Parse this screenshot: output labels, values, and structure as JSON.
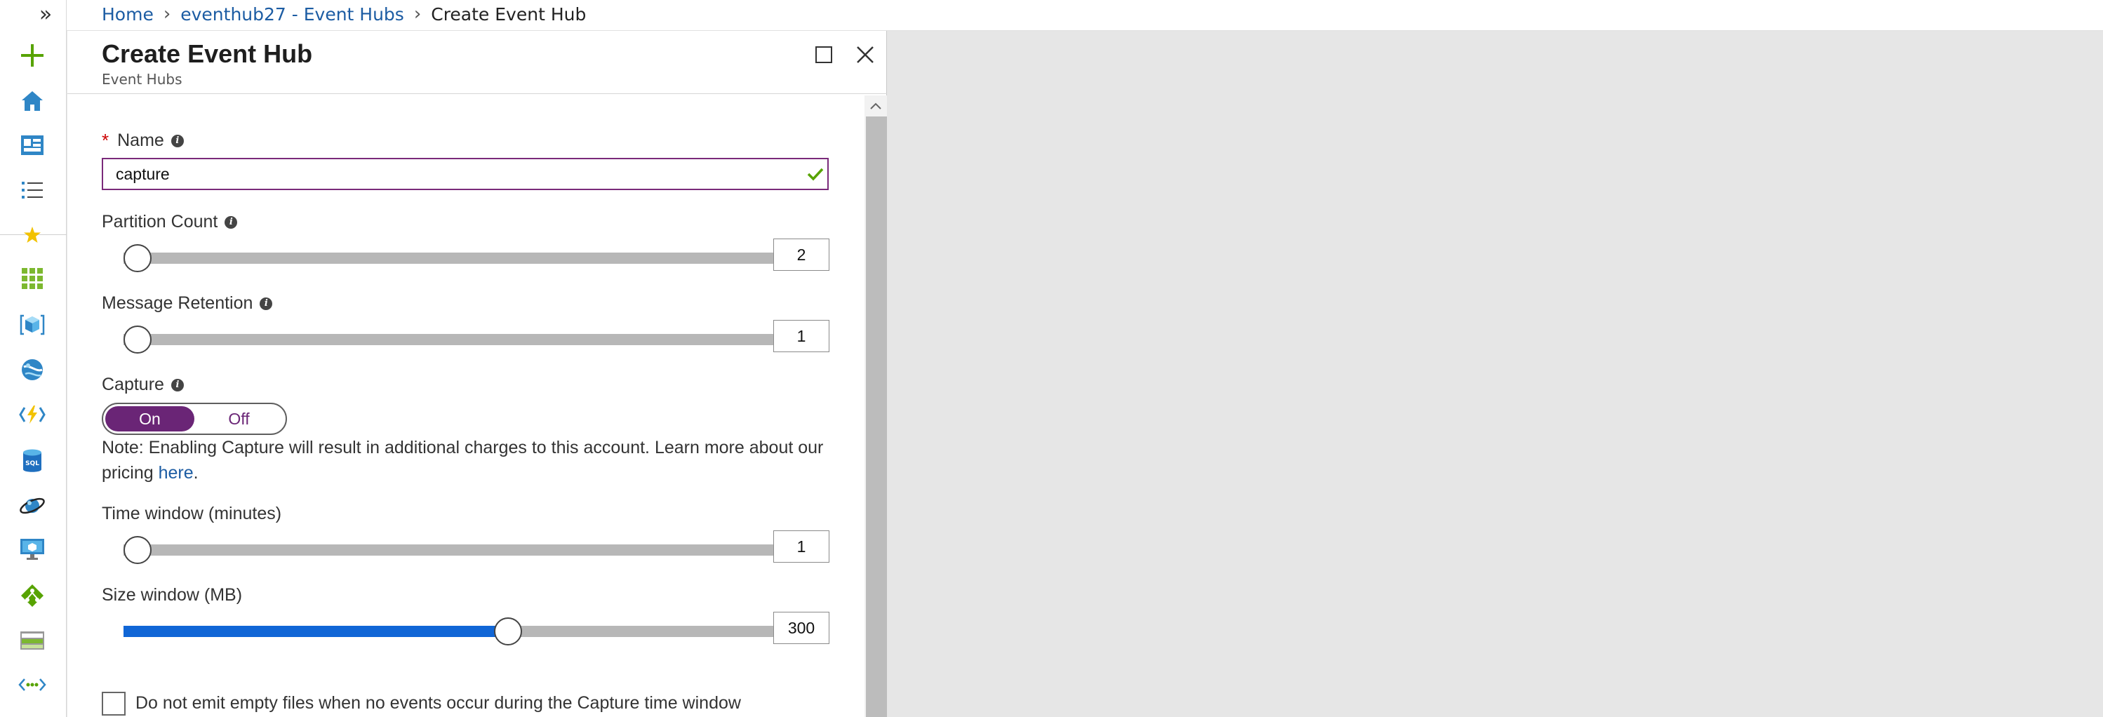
{
  "breadcrumb": {
    "items": [
      "Home",
      "eventhub27 - Event Hubs"
    ],
    "current": "Create Event Hub"
  },
  "blade": {
    "title": "Create Event Hub",
    "subtitle": "Event Hubs"
  },
  "form": {
    "name": {
      "label": "Name",
      "value": "capture",
      "valid": true
    },
    "partition_count": {
      "label": "Partition Count",
      "value": "2",
      "slider_fraction": 0
    },
    "message_retention": {
      "label": "Message Retention",
      "value": "1",
      "slider_fraction": 0
    },
    "capture": {
      "label": "Capture",
      "on_label": "On",
      "off_label": "Off",
      "selected": "On",
      "note": "Note: Enabling Capture will result in additional charges to this account. Learn more about our pricing ",
      "note_link": "here",
      "note_end": "."
    },
    "time_window": {
      "label": "Time window (minutes)",
      "value": "1",
      "slider_fraction": 0
    },
    "size_window": {
      "label": "Size window (MB)",
      "value": "300",
      "slider_fraction": 0.58
    },
    "empty_files": {
      "label": "Do not emit empty files when no events occur during the Capture time window",
      "checked": false
    }
  },
  "colors": {
    "accent_purple": "#6a2576",
    "slider_fill": "#1066d6",
    "link": "#1c5ca3",
    "valid_check": "#57a300"
  },
  "icons": [
    "expand-icon",
    "plus-icon",
    "home-icon",
    "dashboard-icon",
    "all-services-icon",
    "favorites-star-icon",
    "all-resources-icon",
    "resource-groups-icon",
    "app-services-icon",
    "function-apps-icon",
    "sql-databases-icon",
    "cosmos-db-icon",
    "virtual-machines-icon",
    "load-balancers-icon",
    "storage-accounts-icon",
    "virtual-networks-icon",
    "info-icon",
    "checkmark-icon",
    "maximize-icon",
    "close-icon",
    "scroll-up-icon"
  ]
}
